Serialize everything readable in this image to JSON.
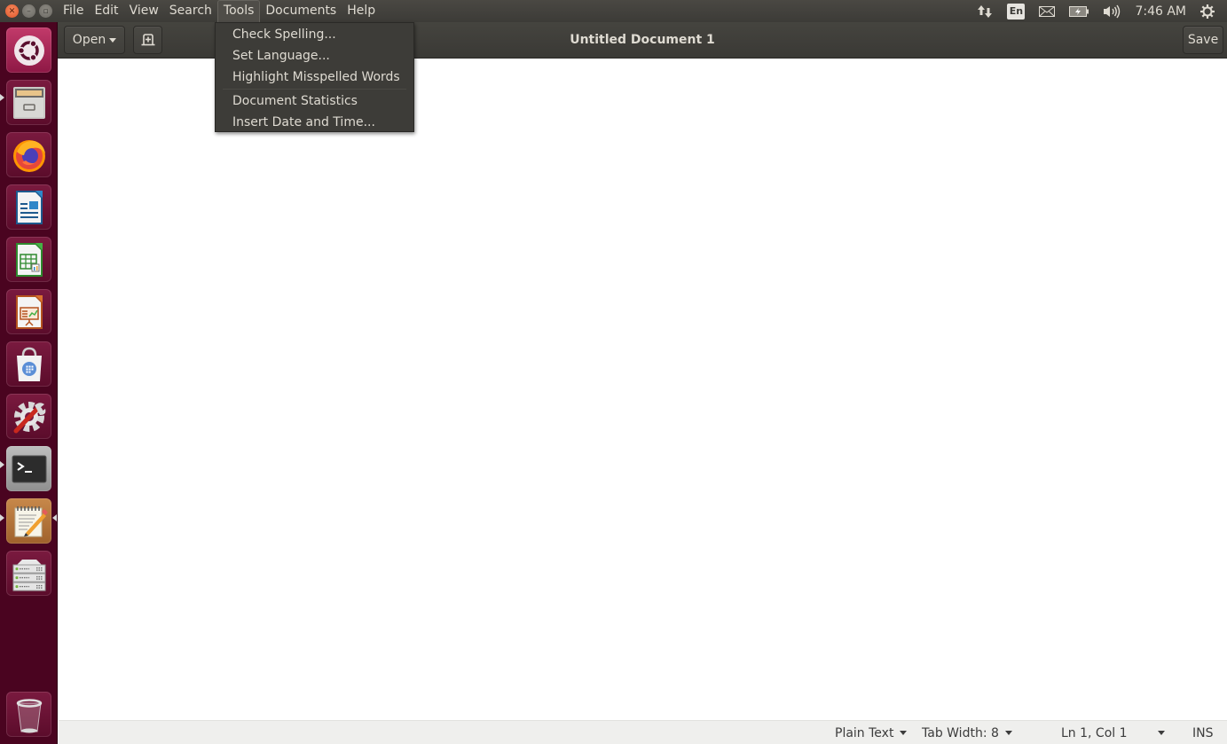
{
  "top_panel": {
    "menus": [
      {
        "label": "File"
      },
      {
        "label": "Edit"
      },
      {
        "label": "View"
      },
      {
        "label": "Search"
      },
      {
        "label": "Tools",
        "active": true
      },
      {
        "label": "Documents"
      },
      {
        "label": "Help"
      }
    ],
    "indicators": {
      "network": "network-transfer-icon",
      "keyboard_layout": "En",
      "mail": "mail-icon",
      "battery": "battery-charging-icon",
      "volume": "volume-icon",
      "clock": "7:46 AM",
      "system": "gear-icon"
    }
  },
  "launcher": {
    "items": [
      {
        "name": "ubuntu-dash",
        "icon": "ubuntu-logo-icon"
      },
      {
        "name": "files",
        "icon": "file-cabinet-icon",
        "running": true
      },
      {
        "name": "firefox",
        "icon": "firefox-icon"
      },
      {
        "name": "libreoffice-writer",
        "icon": "writer-icon"
      },
      {
        "name": "libreoffice-calc",
        "icon": "calc-icon"
      },
      {
        "name": "libreoffice-impress",
        "icon": "impress-icon"
      },
      {
        "name": "software-center",
        "icon": "shopping-bag-icon"
      },
      {
        "name": "system-settings",
        "icon": "settings-wrench-icon"
      },
      {
        "name": "terminal",
        "icon": "terminal-icon",
        "running": true
      },
      {
        "name": "text-editor",
        "icon": "text-editor-icon",
        "running": true,
        "focused": true
      },
      {
        "name": "server-tool",
        "icon": "server-rack-icon"
      },
      {
        "name": "trash",
        "icon": "trash-icon"
      }
    ]
  },
  "headerbar": {
    "open_label": "Open",
    "title": "Untitled Document 1",
    "save_label": "Save"
  },
  "tools_menu": {
    "items": [
      {
        "label": "Check Spelling..."
      },
      {
        "label": "Set Language..."
      },
      {
        "label": "Highlight Misspelled Words"
      },
      {
        "separator": true
      },
      {
        "label": "Document Statistics"
      },
      {
        "label": "Insert Date and Time..."
      }
    ]
  },
  "editor": {
    "content": ""
  },
  "statusbar": {
    "language": "Plain Text",
    "tab_width": "Tab Width: 8",
    "position": "Ln 1, Col 1",
    "mode": "INS"
  }
}
